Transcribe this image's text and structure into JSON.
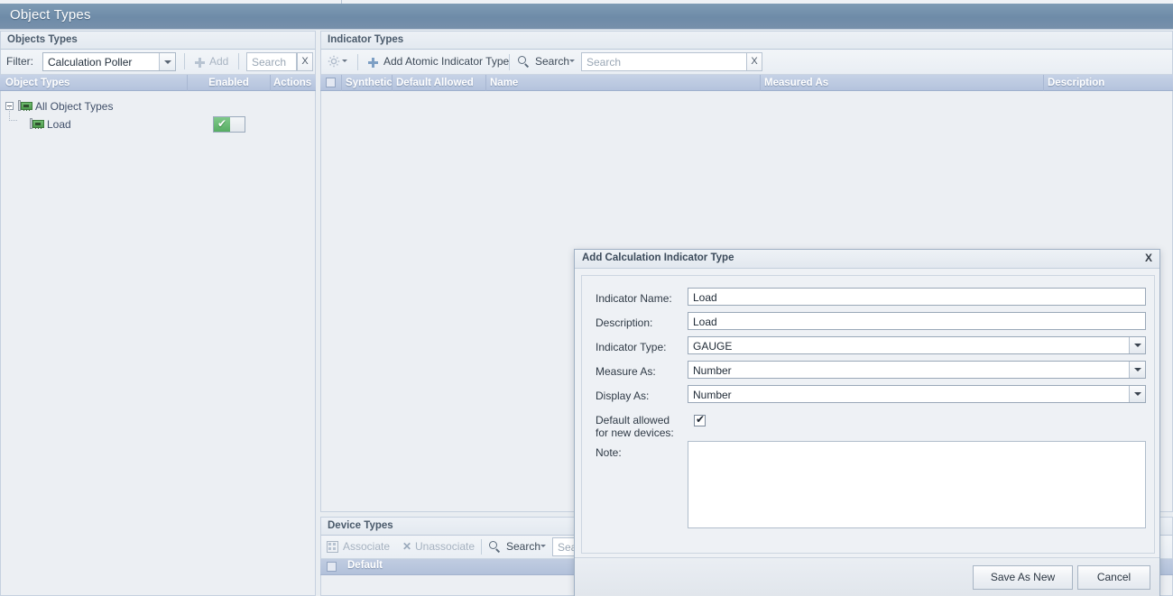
{
  "window": {
    "title": "Object Types"
  },
  "left_panel": {
    "header": "Objects Types",
    "toolbar": {
      "filter_label": "Filter:",
      "filter_value": "Calculation Poller",
      "add_label": "Add",
      "add_icon": "plus-icon",
      "search_placeholder": "Search",
      "clear_label": "X"
    },
    "columns": [
      "Object Types",
      "Enabled",
      "Actions"
    ],
    "tree": [
      {
        "label": "All Object Types",
        "icon": "network-card-icon",
        "level": 0,
        "expanded": true
      },
      {
        "label": "Load",
        "icon": "network-card-icon",
        "level": 1,
        "enabled": true
      }
    ]
  },
  "indicator_panel": {
    "header": "Indicator Types",
    "toolbar": {
      "gear_icon": "gear-icon",
      "gear_caret": "chevron-down-icon",
      "add_atomic_label": "Add Atomic Indicator Type",
      "add_icon": "plus-icon",
      "search_label": "Search",
      "search_caret": "chevron-down-icon",
      "search_placeholder": "Search",
      "clear_label": "X"
    },
    "columns": [
      "Synthetic",
      "Default Allowed",
      "Name",
      "Measured As",
      "Description"
    ],
    "rows": []
  },
  "device_panel": {
    "header": "Device Types",
    "toolbar": {
      "associate_label": "Associate",
      "associate_icon": "associate-icon",
      "unassociate_label": "Unassociate",
      "unassociate_icon": "x-icon",
      "search_label": "Search",
      "search_caret": "chevron-down-icon",
      "search_placeholder": "Sea"
    },
    "columns": [
      "Default"
    ]
  },
  "dialog": {
    "title": "Add Calculation Indicator Type",
    "close_label": "X",
    "fields": {
      "indicator_name_label": "Indicator Name:",
      "indicator_name_value": "Load",
      "description_label": "Description:",
      "description_value": "Load",
      "indicator_type_label": "Indicator Type:",
      "indicator_type_value": "GAUGE",
      "measure_as_label": "Measure As:",
      "measure_as_value": "Number",
      "display_as_label": "Display As:",
      "display_as_value": "Number",
      "default_allowed_label_line1": "Default allowed",
      "default_allowed_label_line2": "for new devices:",
      "default_allowed_checked": "✔",
      "note_label": "Note:",
      "note_value": ""
    },
    "buttons": {
      "save_label": "Save As New",
      "cancel_label": "Cancel"
    }
  },
  "colors": {
    "titlebar": "#6e8ba8",
    "grid_header": "#b4c3dd",
    "accent_plus": "#7d9fc4",
    "toggle_on": "#57ad63",
    "page_bg": "#e9edf1"
  }
}
